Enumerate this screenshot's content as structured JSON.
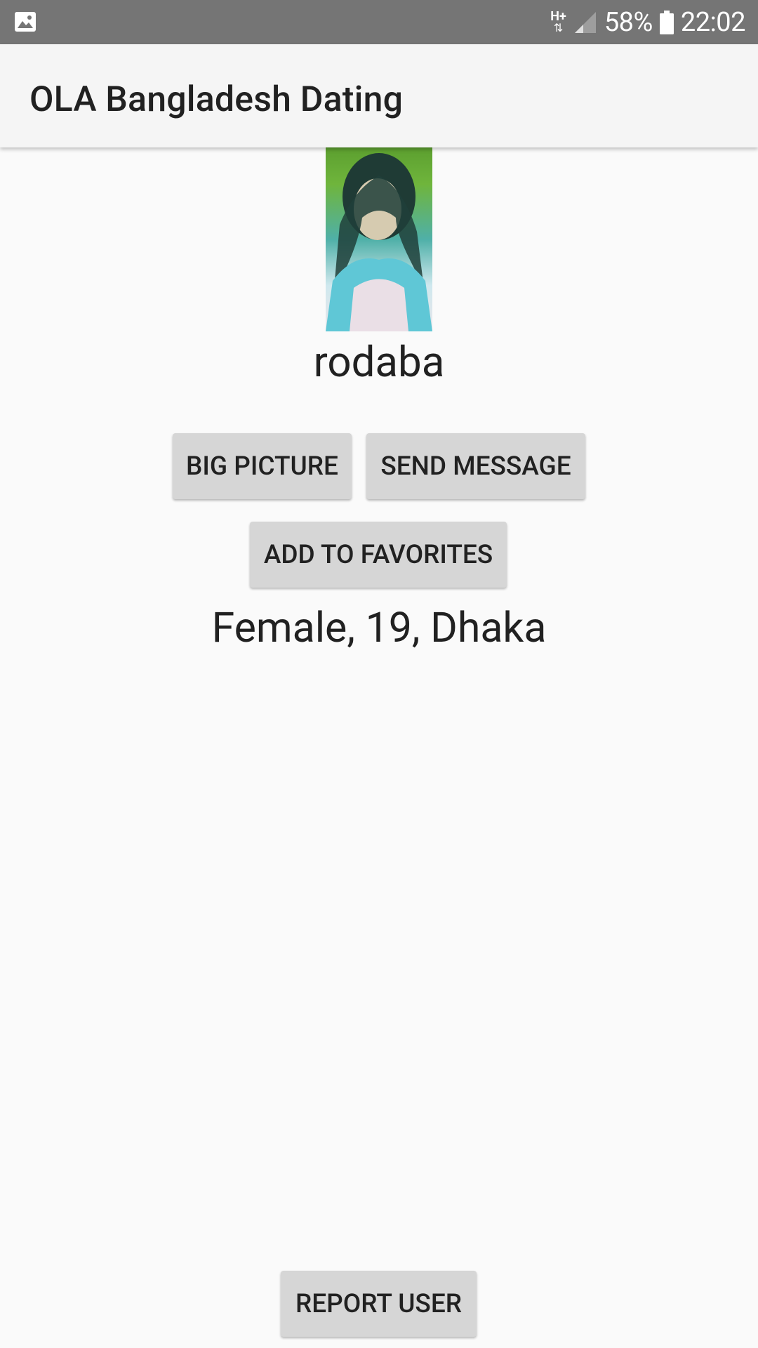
{
  "status_bar": {
    "network": "H+",
    "battery": "58%",
    "time": "22:02"
  },
  "app_bar": {
    "title": "OLA Bangladesh Dating"
  },
  "profile": {
    "name": "rodaba",
    "details": "Female, 19, Dhaka"
  },
  "buttons": {
    "big_picture": "BIG PICTURE",
    "send_message": "SEND MESSAGE",
    "add_to_favorites": "ADD TO FAVORITES",
    "report_user": "REPORT USER"
  },
  "colors": {
    "status_bar": "#757575",
    "app_bar": "#f5f5f5",
    "background": "#fafafa",
    "button": "#d6d6d6",
    "text": "#212121"
  },
  "icons": [
    "image-notification-icon",
    "network-signal-icon",
    "battery-icon"
  ]
}
